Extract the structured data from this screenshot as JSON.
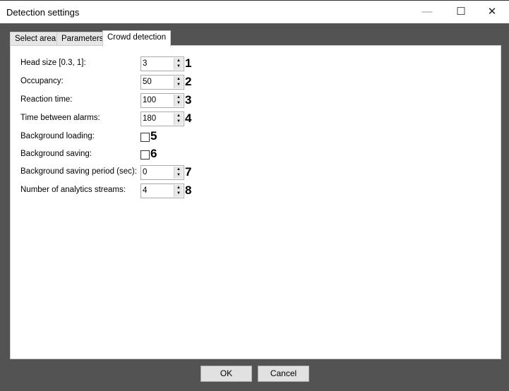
{
  "window": {
    "title": "Detection settings",
    "minimize": "—",
    "maximize": "☐",
    "close": "✕"
  },
  "tabs": [
    "Select area",
    "Parameters",
    "Crowd detection"
  ],
  "fields": [
    {
      "label": "Head size [0.3, 1]:",
      "value": "3",
      "marker": "1",
      "type": "spin"
    },
    {
      "label": "Occupancy:",
      "value": "50",
      "marker": "2",
      "type": "spin"
    },
    {
      "label": "Reaction time:",
      "value": "100",
      "marker": "3",
      "type": "spin"
    },
    {
      "label": "Time between alarms:",
      "value": "180",
      "marker": "4",
      "type": "spin"
    },
    {
      "label": "Background loading:",
      "checked": false,
      "marker": "5",
      "type": "check"
    },
    {
      "label": "Background saving:",
      "checked": false,
      "marker": "6",
      "type": "check"
    },
    {
      "label": "Background saving period (sec):",
      "value": "0",
      "marker": "7",
      "type": "spin"
    },
    {
      "label": "Number of analytics streams:",
      "value": "4",
      "marker": "8",
      "type": "spin"
    }
  ],
  "buttons": {
    "ok": "OK",
    "cancel": "Cancel"
  }
}
